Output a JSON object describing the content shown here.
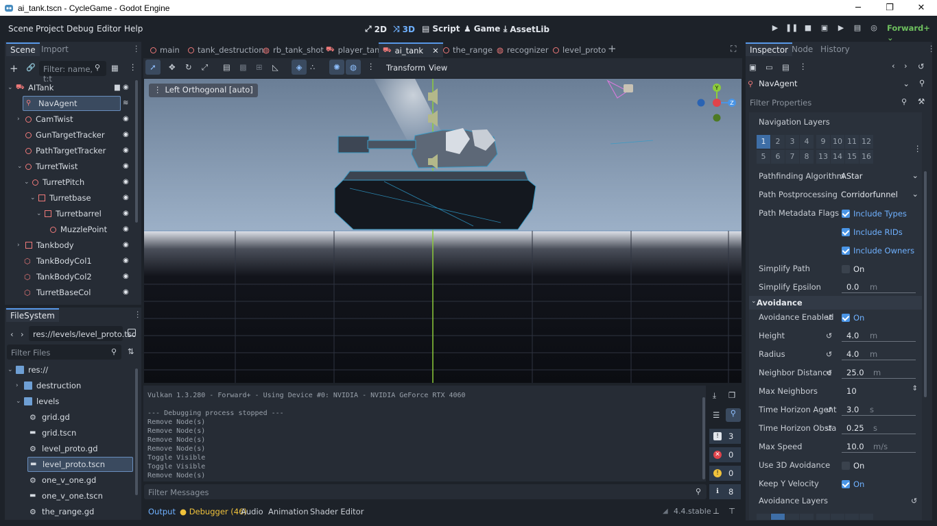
{
  "window": {
    "title": "ai_tank.tscn - CycleGame - Godot Engine",
    "min": "─",
    "restore": "❐",
    "close": "✕"
  },
  "menu": [
    "Scene",
    "Project",
    "Debug",
    "Editor",
    "Help"
  ],
  "workspaces": [
    {
      "label": "2D",
      "icon": "2d-icon"
    },
    {
      "label": "3D",
      "icon": "3d-icon"
    },
    {
      "label": "Script",
      "icon": "script-icon"
    },
    {
      "label": "Game",
      "icon": "game-icon"
    },
    {
      "label": "AssetLib",
      "icon": "assetlib-icon"
    }
  ],
  "renderer": "Forward+",
  "scene_dock": {
    "tabs": [
      "Scene",
      "Import"
    ],
    "filter_placeholder": "Filter: name, t:t",
    "nodes": [
      {
        "label": "AITank",
        "depth": 0,
        "icon": "vehicle-icon",
        "color": "#f07a7a"
      },
      {
        "label": "NavAgent",
        "depth": 1,
        "icon": "nav-agent-icon",
        "color": "#f07a7a",
        "selected": true
      },
      {
        "label": "CamTwist",
        "depth": 1,
        "icon": "node3d-icon",
        "color": "#f07a7a"
      },
      {
        "label": "GunTargetTracker",
        "depth": 1,
        "icon": "node3d-icon",
        "color": "#f07a7a"
      },
      {
        "label": "PathTargetTracker",
        "depth": 1,
        "icon": "node3d-icon",
        "color": "#f07a7a"
      },
      {
        "label": "TurretTwist",
        "depth": 1,
        "icon": "node3d-icon",
        "color": "#f07a7a"
      },
      {
        "label": "TurretPitch",
        "depth": 2,
        "icon": "node3d-icon",
        "color": "#f07a7a"
      },
      {
        "label": "Turretbase",
        "depth": 3,
        "icon": "mesh-icon",
        "color": "#f07a7a"
      },
      {
        "label": "Turretbarrel",
        "depth": 4,
        "icon": "mesh-icon",
        "color": "#f07a7a"
      },
      {
        "label": "MuzzlePoint",
        "depth": 5,
        "icon": "node3d-icon",
        "color": "#f07a7a"
      },
      {
        "label": "Tankbody",
        "depth": 1,
        "icon": "mesh-icon",
        "color": "#f07a7a"
      },
      {
        "label": "TankBodyCol1",
        "depth": 1,
        "icon": "collision-icon",
        "color": "#f07a7a"
      },
      {
        "label": "TankBodyCol2",
        "depth": 1,
        "icon": "collision-icon",
        "color": "#f07a7a"
      },
      {
        "label": "TurretBaseCol",
        "depth": 1,
        "icon": "collision-icon",
        "color": "#f07a7a"
      }
    ]
  },
  "filesystem": {
    "title": "FileSystem",
    "path": "res://levels/level_proto.tsc",
    "filter_placeholder": "Filter Files",
    "items": [
      {
        "label": "res://",
        "depth": 0,
        "icon": "folder-icon"
      },
      {
        "label": "destruction",
        "depth": 1,
        "icon": "folder-icon"
      },
      {
        "label": "levels",
        "depth": 1,
        "icon": "folder-icon"
      },
      {
        "label": "grid.gd",
        "depth": 2,
        "icon": "gear-icon"
      },
      {
        "label": "grid.tscn",
        "depth": 2,
        "icon": "clapper-icon"
      },
      {
        "label": "level_proto.gd",
        "depth": 2,
        "icon": "gear-icon"
      },
      {
        "label": "level_proto.tscn",
        "depth": 2,
        "icon": "clapper-icon",
        "selected": true
      },
      {
        "label": "one_v_one.gd",
        "depth": 2,
        "icon": "gear-icon"
      },
      {
        "label": "one_v_one.tscn",
        "depth": 2,
        "icon": "clapper-icon"
      },
      {
        "label": "the_range.gd",
        "depth": 2,
        "icon": "gear-icon"
      }
    ]
  },
  "scene_tabs": [
    {
      "label": "main",
      "icon": "ring"
    },
    {
      "label": "tank_destruction",
      "icon": "ring"
    },
    {
      "label": "rb_tank_shot",
      "icon": "rigid"
    },
    {
      "label": "player_tank",
      "icon": "vehicle"
    },
    {
      "label": "ai_tank",
      "icon": "vehicle",
      "active": true
    },
    {
      "label": "the_range",
      "icon": "ring"
    },
    {
      "label": "recognizer",
      "icon": "rigid"
    },
    {
      "label": "level_proto",
      "icon": "ring"
    }
  ],
  "viewport": {
    "toolbar_menus": [
      "Transform",
      "View"
    ],
    "view_label": "Left Orthogonal [auto]"
  },
  "output": {
    "lines": [
      "Vulkan 1.3.280 - Forward+ - Using Device #0: NVIDIA - NVIDIA GeForce RTX 4060",
      "",
      "--- Debugging process stopped ---",
      "Remove Node(s)",
      "Remove Node(s)",
      "Remove Node(s)",
      "Remove Node(s)",
      "Toggle Visible",
      "Toggle Visible",
      "Remove Node(s)"
    ],
    "filter_placeholder": "Filter Messages",
    "counts": {
      "messages": "3",
      "errors": "0",
      "warnings": "0",
      "info": "8"
    },
    "bottom_tabs": [
      "Output",
      "Debugger (46)",
      "Audio",
      "Animation",
      "Shader Editor"
    ],
    "version": "4.4.stable"
  },
  "inspector": {
    "tabs": [
      "Inspector",
      "Node",
      "History"
    ],
    "node_name": "NavAgent",
    "filter_placeholder": "Filter Properties",
    "nav_layers_label": "Navigation Layers",
    "nav_layers": [
      "1",
      "2",
      "3",
      "4",
      "9",
      "10",
      "11",
      "12",
      "5",
      "6",
      "7",
      "8",
      "13",
      "14",
      "15",
      "16"
    ],
    "props": {
      "pathfinding_algorithm": {
        "label": "Pathfinding Algorithm",
        "value": "AStar"
      },
      "path_postprocessing": {
        "label": "Path Postprocessing",
        "value": "Corridorfunnel"
      },
      "path_metadata_flags": {
        "label": "Path Metadata Flags",
        "flags": [
          "Include Types",
          "Include RIDs",
          "Include Owners"
        ]
      },
      "simplify_path": {
        "label": "Simplify Path",
        "value": "On"
      },
      "simplify_epsilon": {
        "label": "Simplify Epsilon",
        "value": "0.0",
        "unit": "m"
      },
      "avoidance_section": "Avoidance",
      "avoidance_enabled": {
        "label": "Avoidance Enabled",
        "value": "On"
      },
      "height": {
        "label": "Height",
        "value": "4.0",
        "unit": "m"
      },
      "radius": {
        "label": "Radius",
        "value": "4.0",
        "unit": "m"
      },
      "neighbor_distance": {
        "label": "Neighbor Distance",
        "value": "25.0",
        "unit": "m"
      },
      "max_neighbors": {
        "label": "Max Neighbors",
        "value": "10"
      },
      "time_horizon_agent": {
        "label": "Time Horizon Agent",
        "value": "3.0",
        "unit": "s"
      },
      "time_horizon_obsta": {
        "label": "Time Horizon Obsta",
        "value": "0.25",
        "unit": "s"
      },
      "max_speed": {
        "label": "Max Speed",
        "value": "10.0",
        "unit": "m/s"
      },
      "use_3d_avoidance": {
        "label": "Use 3D Avoidance",
        "value": "On"
      },
      "keep_y_velocity": {
        "label": "Keep Y Velocity",
        "value": "On"
      },
      "avoidance_layers": {
        "label": "Avoidance Layers"
      }
    }
  },
  "colors": {
    "accent": "#5898e8",
    "panel": "#262c35",
    "bg": "#1d2229",
    "node_red": "#f07a7a",
    "renderer_green": "#6ec05e"
  }
}
